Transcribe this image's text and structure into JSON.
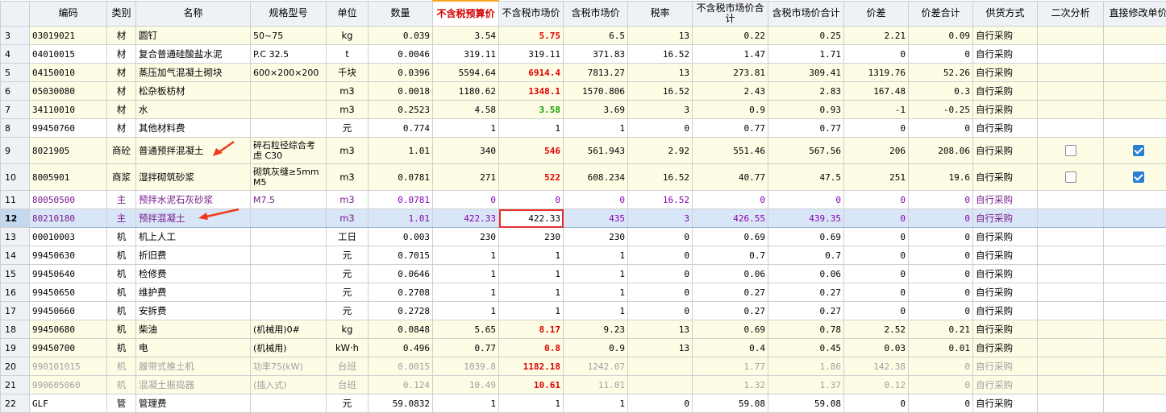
{
  "columns": [
    "编码",
    "类别",
    "名称",
    "规格型号",
    "单位",
    "数量",
    "不含税预算价",
    "不含税市场价",
    "含税市场价",
    "税率",
    "不含税市场价合计",
    "含税市场价合计",
    "价差",
    "价差合计",
    "供货方式",
    "二次分析",
    "直接修改单价"
  ],
  "rows": [
    {
      "n": "3",
      "code": "03019021",
      "type": "材",
      "name": "圆钉",
      "spec": "50~75",
      "unit": "kg",
      "qty": "0.039",
      "budget": "3.54",
      "market": "5.75",
      "tax_price": "6.5",
      "rate": "13",
      "sum": "0.22",
      "tax_sum": "0.25",
      "diff": "2.21",
      "diff_sum": "0.09",
      "supply": "自行采购",
      "style": "y",
      "mstyle": "red"
    },
    {
      "n": "4",
      "code": "04010015",
      "type": "材",
      "name": "复合普通硅酸盐水泥",
      "spec": "P.C 32.5",
      "unit": "t",
      "qty": "0.0046",
      "budget": "319.11",
      "market": "319.11",
      "tax_price": "371.83",
      "rate": "16.52",
      "sum": "1.47",
      "tax_sum": "1.71",
      "diff": "0",
      "diff_sum": "0",
      "supply": "自行采购",
      "style": "w",
      "mstyle": ""
    },
    {
      "n": "5",
      "code": "04150010",
      "type": "材",
      "name": "蒸压加气混凝土砌块",
      "spec": "600×200×200",
      "unit": "千块",
      "qty": "0.0396",
      "budget": "5594.64",
      "market": "6914.4",
      "tax_price": "7813.27",
      "rate": "13",
      "sum": "273.81",
      "tax_sum": "309.41",
      "diff": "1319.76",
      "diff_sum": "52.26",
      "supply": "自行采购",
      "style": "y",
      "mstyle": "red"
    },
    {
      "n": "6",
      "code": "05030080",
      "type": "材",
      "name": "松杂板枋材",
      "spec": "",
      "unit": "m3",
      "qty": "0.0018",
      "budget": "1180.62",
      "market": "1348.1",
      "tax_price": "1570.806",
      "rate": "16.52",
      "sum": "2.43",
      "tax_sum": "2.83",
      "diff": "167.48",
      "diff_sum": "0.3",
      "supply": "自行采购",
      "style": "y",
      "mstyle": "red"
    },
    {
      "n": "7",
      "code": "34110010",
      "type": "材",
      "name": "水",
      "spec": "",
      "unit": "m3",
      "qty": "0.2523",
      "budget": "4.58",
      "market": "3.58",
      "tax_price": "3.69",
      "rate": "3",
      "sum": "0.9",
      "tax_sum": "0.93",
      "diff": "-1",
      "diff_sum": "-0.25",
      "supply": "自行采购",
      "style": "y",
      "mstyle": "green"
    },
    {
      "n": "8",
      "code": "99450760",
      "type": "材",
      "name": "其他材料费",
      "spec": "",
      "unit": "元",
      "qty": "0.774",
      "budget": "1",
      "market": "1",
      "tax_price": "1",
      "rate": "0",
      "sum": "0.77",
      "tax_sum": "0.77",
      "diff": "0",
      "diff_sum": "0",
      "supply": "自行采购",
      "style": "w",
      "mstyle": ""
    },
    {
      "n": "9",
      "code": "8021905",
      "type": "商砼",
      "name": "普通预拌混凝土",
      "spec": "碎石粒径综合考虑 C30",
      "unit": "m3",
      "qty": "1.01",
      "budget": "340",
      "market": "546",
      "tax_price": "561.943",
      "rate": "2.92",
      "sum": "551.46",
      "tax_sum": "567.56",
      "diff": "206",
      "diff_sum": "208.06",
      "supply": "自行采购",
      "style": "y",
      "mstyle": "red",
      "tall": true,
      "cb1": false,
      "cb2": true
    },
    {
      "n": "10",
      "code": "8005901",
      "type": "商浆",
      "name": "湿拌砌筑砂浆",
      "spec": "砌筑灰缝≥5mm M5",
      "unit": "m3",
      "qty": "0.0781",
      "budget": "271",
      "market": "522",
      "tax_price": "608.234",
      "rate": "16.52",
      "sum": "40.77",
      "tax_sum": "47.5",
      "diff": "251",
      "diff_sum": "19.6",
      "supply": "自行采购",
      "style": "y",
      "mstyle": "red",
      "tall": true,
      "cb1": false,
      "cb2": true
    },
    {
      "n": "11",
      "code": "80050500",
      "type": "主",
      "name": "预拌水泥石灰砂浆",
      "spec": "M7.5",
      "unit": "m3",
      "qty": "0.0781",
      "budget": "0",
      "market": "0",
      "tax_price": "0",
      "rate": "16.52",
      "sum": "0",
      "tax_sum": "0",
      "diff": "0",
      "diff_sum": "0",
      "supply": "自行采购",
      "style": "w purple",
      "mstyle": ""
    },
    {
      "n": "12",
      "code": "80210180",
      "type": "主",
      "name": "预拌混凝土",
      "spec": "",
      "unit": "m3",
      "qty": "1.01",
      "budget": "422.33",
      "market": "422.33",
      "tax_price": "435",
      "rate": "3",
      "sum": "426.55",
      "tax_sum": "439.35",
      "diff": "0",
      "diff_sum": "0",
      "supply": "自行采购",
      "style": "sel purple",
      "mstyle": "redbox"
    },
    {
      "n": "13",
      "code": "00010003",
      "type": "机",
      "name": "机上人工",
      "spec": "",
      "unit": "工日",
      "qty": "0.003",
      "budget": "230",
      "market": "230",
      "tax_price": "230",
      "rate": "0",
      "sum": "0.69",
      "tax_sum": "0.69",
      "diff": "0",
      "diff_sum": "0",
      "supply": "自行采购",
      "style": "w",
      "mstyle": ""
    },
    {
      "n": "14",
      "code": "99450630",
      "type": "机",
      "name": "折旧费",
      "spec": "",
      "unit": "元",
      "qty": "0.7015",
      "budget": "1",
      "market": "1",
      "tax_price": "1",
      "rate": "0",
      "sum": "0.7",
      "tax_sum": "0.7",
      "diff": "0",
      "diff_sum": "0",
      "supply": "自行采购",
      "style": "w",
      "mstyle": ""
    },
    {
      "n": "15",
      "code": "99450640",
      "type": "机",
      "name": "检修费",
      "spec": "",
      "unit": "元",
      "qty": "0.0646",
      "budget": "1",
      "market": "1",
      "tax_price": "1",
      "rate": "0",
      "sum": "0.06",
      "tax_sum": "0.06",
      "diff": "0",
      "diff_sum": "0",
      "supply": "自行采购",
      "style": "w",
      "mstyle": ""
    },
    {
      "n": "16",
      "code": "99450650",
      "type": "机",
      "name": "维护费",
      "spec": "",
      "unit": "元",
      "qty": "0.2708",
      "budget": "1",
      "market": "1",
      "tax_price": "1",
      "rate": "0",
      "sum": "0.27",
      "tax_sum": "0.27",
      "diff": "0",
      "diff_sum": "0",
      "supply": "自行采购",
      "style": "w",
      "mstyle": ""
    },
    {
      "n": "17",
      "code": "99450660",
      "type": "机",
      "name": "安拆费",
      "spec": "",
      "unit": "元",
      "qty": "0.2728",
      "budget": "1",
      "market": "1",
      "tax_price": "1",
      "rate": "0",
      "sum": "0.27",
      "tax_sum": "0.27",
      "diff": "0",
      "diff_sum": "0",
      "supply": "自行采购",
      "style": "w",
      "mstyle": ""
    },
    {
      "n": "18",
      "code": "99450680",
      "type": "机",
      "name": "柴油",
      "spec": "(机械用)0#",
      "unit": "kg",
      "qty": "0.0848",
      "budget": "5.65",
      "market": "8.17",
      "tax_price": "9.23",
      "rate": "13",
      "sum": "0.69",
      "tax_sum": "0.78",
      "diff": "2.52",
      "diff_sum": "0.21",
      "supply": "自行采购",
      "style": "y",
      "mstyle": "red"
    },
    {
      "n": "19",
      "code": "99450700",
      "type": "机",
      "name": "电",
      "spec": "(机械用)",
      "unit": "kW·h",
      "qty": "0.496",
      "budget": "0.77",
      "market": "0.8",
      "tax_price": "0.9",
      "rate": "13",
      "sum": "0.4",
      "tax_sum": "0.45",
      "diff": "0.03",
      "diff_sum": "0.01",
      "supply": "自行采购",
      "style": "y",
      "mstyle": "red"
    },
    {
      "n": "20",
      "code": "990101015",
      "type": "机",
      "name": "履带式推土机",
      "spec": "功率75(kW)",
      "unit": "台班",
      "qty": "0.0015",
      "budget": "1039.8",
      "market": "1182.18",
      "tax_price": "1242.07",
      "rate": "",
      "sum": "1.77",
      "tax_sum": "1.86",
      "diff": "142.38",
      "diff_sum": "0",
      "supply": "自行采购",
      "style": "y grey",
      "mstyle": "red"
    },
    {
      "n": "21",
      "code": "990605060",
      "type": "机",
      "name": "混凝土振捣器",
      "spec": "(插入式)",
      "unit": "台班",
      "qty": "0.124",
      "budget": "10.49",
      "market": "10.61",
      "tax_price": "11.01",
      "rate": "",
      "sum": "1.32",
      "tax_sum": "1.37",
      "diff": "0.12",
      "diff_sum": "0",
      "supply": "自行采购",
      "style": "y grey",
      "mstyle": "red"
    },
    {
      "n": "22",
      "code": "GLF",
      "type": "管",
      "name": "管理费",
      "spec": "",
      "unit": "元",
      "qty": "59.0832",
      "budget": "1",
      "market": "1",
      "tax_price": "1",
      "rate": "0",
      "sum": "59.08",
      "tax_sum": "59.08",
      "diff": "0",
      "diff_sum": "0",
      "supply": "自行采购",
      "style": "w",
      "mstyle": ""
    }
  ]
}
